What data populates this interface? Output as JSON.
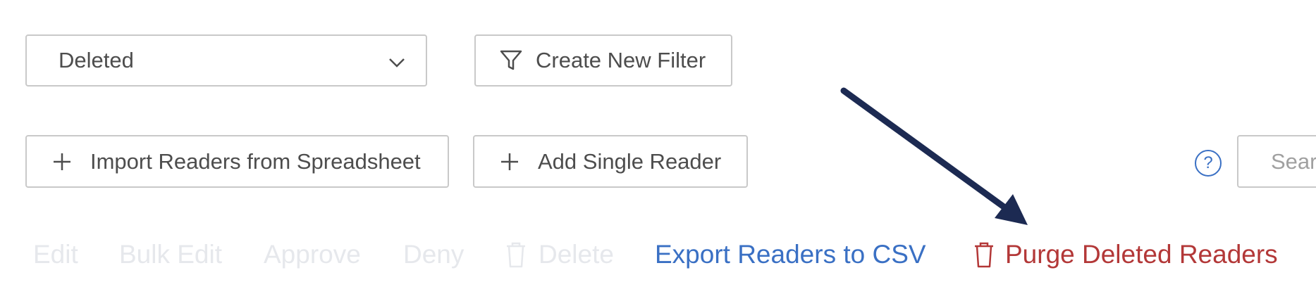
{
  "filters": {
    "status_value": "Deleted",
    "create_filter_label": "Create New Filter"
  },
  "toolbar": {
    "import_label": "Import Readers from Spreadsheet",
    "add_single_label": "Add Single Reader",
    "help_symbol": "?",
    "search_placeholder": "Search"
  },
  "actions": {
    "edit": "Edit",
    "bulk_edit": "Bulk Edit",
    "approve": "Approve",
    "deny": "Deny",
    "delete": "Delete",
    "export_csv": "Export Readers to CSV",
    "purge_deleted": "Purge Deleted Readers"
  },
  "colors": {
    "link_blue": "#3a70c4",
    "danger_red": "#b33838",
    "disabled_gray": "#e6e8ec",
    "arrow_navy": "#1c2a52",
    "border_gray": "#c9c9c9"
  },
  "icons": {
    "dropdown": "chevron-down-icon",
    "filter": "funnel-icon",
    "add": "plus-icon",
    "help": "help-circle-icon",
    "delete": "trash-icon",
    "annotation": "arrow-annotation"
  }
}
